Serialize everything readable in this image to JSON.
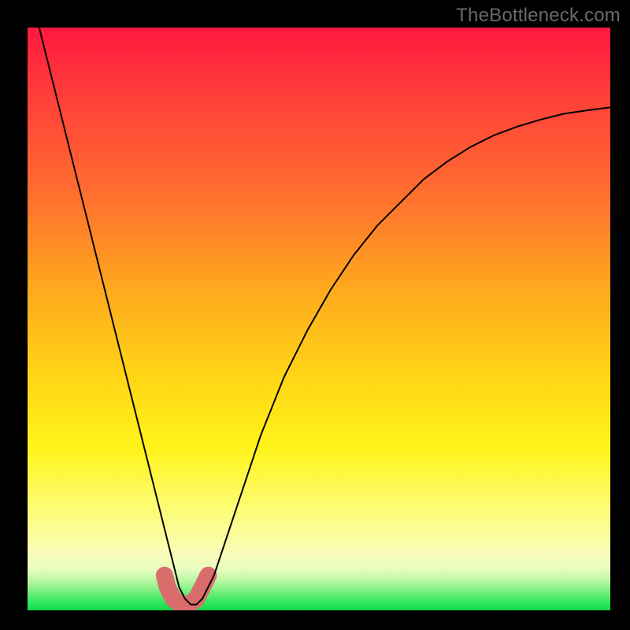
{
  "watermark": "TheBottleneck.com",
  "chart_data": {
    "type": "line",
    "title": "",
    "xlabel": "",
    "ylabel": "",
    "x_range": [
      0,
      100
    ],
    "y_range": [
      0,
      100
    ],
    "series": [
      {
        "name": "bottleneck-curve",
        "x": [
          0,
          2,
          4,
          6,
          8,
          10,
          12,
          14,
          16,
          18,
          20,
          22,
          24,
          25,
          26,
          27,
          28,
          29,
          30,
          32,
          34,
          36,
          38,
          40,
          44,
          48,
          52,
          56,
          60,
          64,
          68,
          72,
          76,
          80,
          84,
          88,
          92,
          96,
          100
        ],
        "y": [
          110,
          100,
          92,
          84,
          76,
          68,
          60,
          52,
          44,
          36,
          28,
          20,
          12,
          8,
          4,
          2,
          1,
          1,
          2,
          6,
          12,
          18,
          24,
          30,
          40,
          48,
          55,
          61,
          66,
          70,
          74,
          77,
          79.5,
          81.5,
          83,
          84.2,
          85.2,
          85.8,
          86.3
        ]
      }
    ],
    "highlight": {
      "name": "curve-bottom",
      "x": [
        23.5,
        24,
        25,
        26,
        27,
        28,
        29,
        30,
        31
      ],
      "y": [
        6,
        4,
        2,
        1.2,
        1,
        1.2,
        2,
        4,
        6
      ]
    },
    "background_gradient_stops": [
      {
        "pct": 0,
        "color": "#ff173f"
      },
      {
        "pct": 45,
        "color": "#ffa91e"
      },
      {
        "pct": 72,
        "color": "#fff31a"
      },
      {
        "pct": 95,
        "color": "#b6f7a0"
      },
      {
        "pct": 100,
        "color": "#16d94e"
      }
    ]
  }
}
